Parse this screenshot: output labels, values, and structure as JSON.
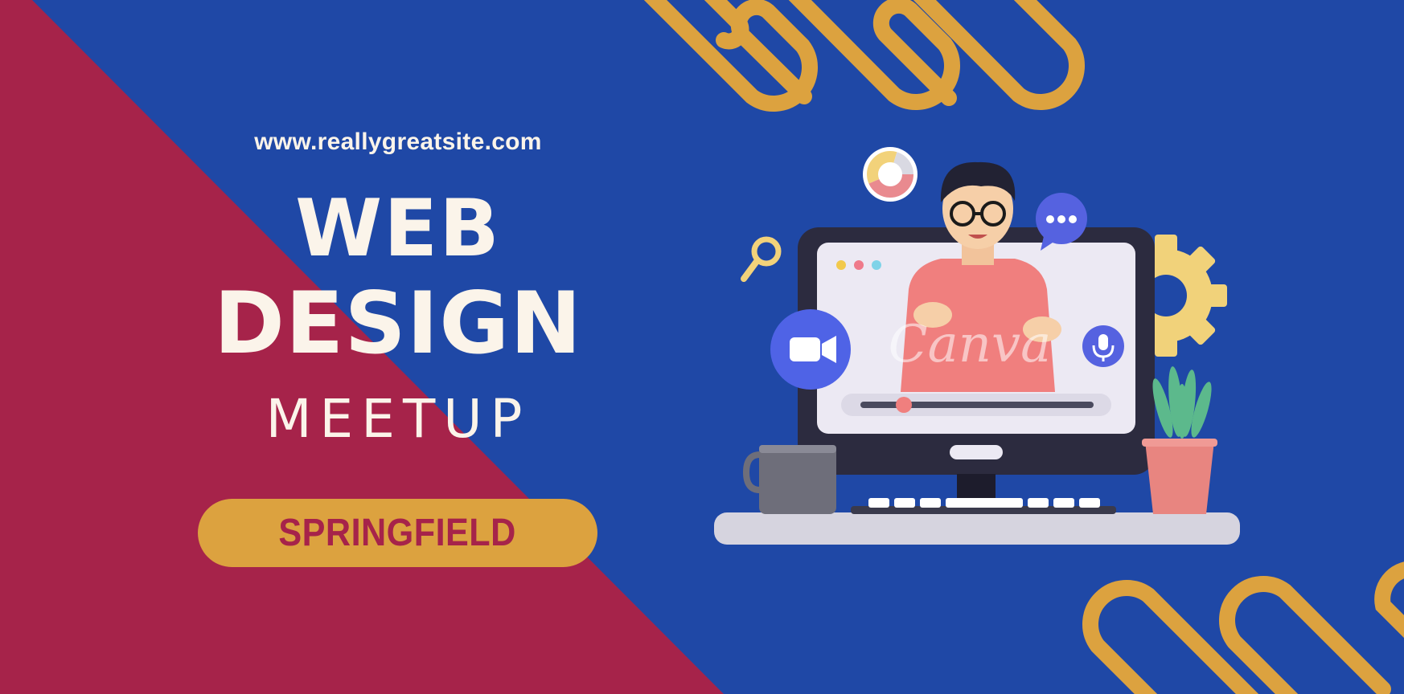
{
  "poster": {
    "url": "www.reallygreatsite.com",
    "title_line1": "WEB",
    "title_line2": "DESIGN",
    "title_line3": "MEETUP",
    "location": "SPRINGFIELD"
  },
  "watermark": {
    "brand": "Canva"
  },
  "colors": {
    "background_blue": "#1f48a6",
    "diagonal_red": "#a6234a",
    "accent_gold": "#dca23f",
    "text_cream": "#fbf4ea"
  },
  "illustration": {
    "icons": [
      "donut-chart-icon",
      "chat-bubble-icon",
      "magnifier-icon",
      "gear-icon",
      "video-camera-icon",
      "microphone-icon",
      "mug-icon",
      "plant-icon"
    ]
  }
}
